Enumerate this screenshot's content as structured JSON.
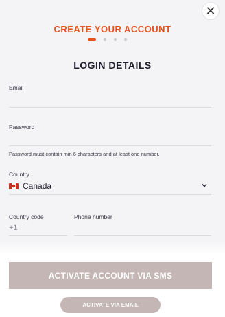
{
  "header": {
    "close_icon": "close-icon",
    "step_title": "CREATE YOUR ACCOUNT",
    "step_title_color": "#e5521d",
    "steps_total": 4,
    "current_step": 1
  },
  "form": {
    "section_title": "LOGIN DETAILS",
    "email": {
      "label": "Email",
      "value": ""
    },
    "password": {
      "label": "Password",
      "value": "",
      "hint": "Password must contain min 6 characters and at least one number."
    },
    "country": {
      "label": "Country",
      "value": "Canada",
      "flag_icon": "canada-flag-icon",
      "dropdown_icon": "chevron-down-icon"
    },
    "country_code": {
      "label": "Country code",
      "value": "+1"
    },
    "phone": {
      "label": "Phone number",
      "value": ""
    }
  },
  "actions": {
    "sms_button": "ACTIVATE ACCOUNT VIA SMS",
    "email_button": "ACTIVATE VIA EMAIL",
    "button_color": "#c4b6b4"
  }
}
